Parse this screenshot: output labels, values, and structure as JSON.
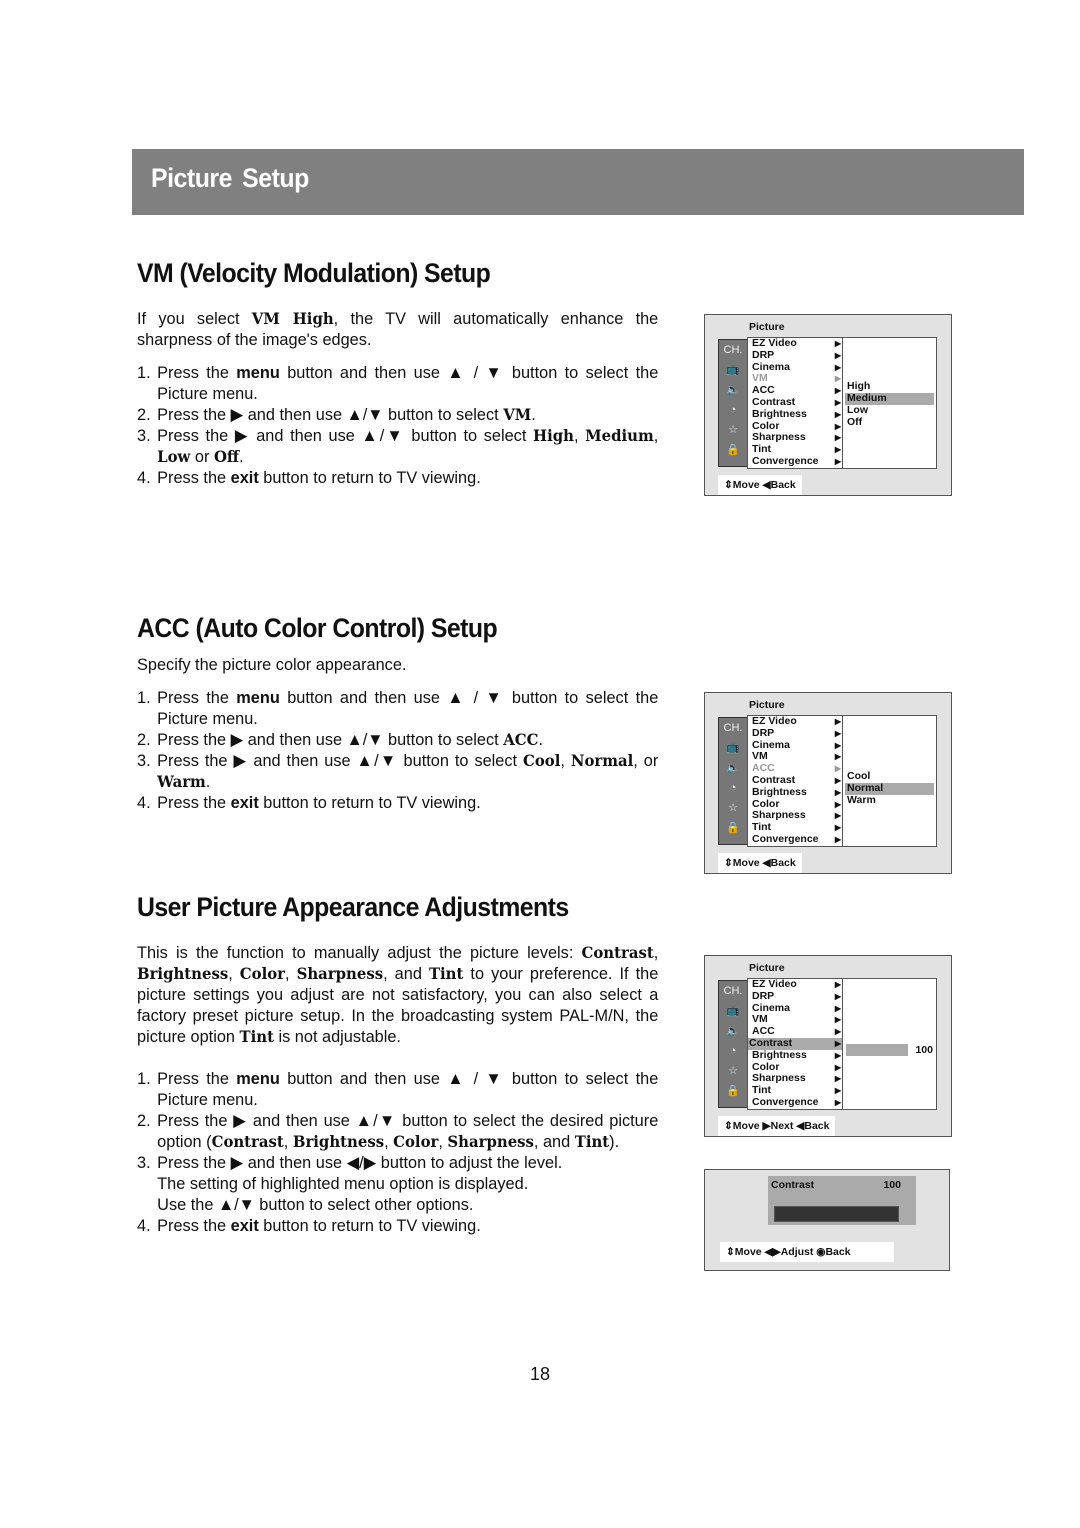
{
  "banner": {
    "title": "Picture  Setup"
  },
  "sections": {
    "vm": {
      "heading": "VM (Velocity Modulation) Setup",
      "intro": [
        "If you select ",
        "VM High",
        ", the TV will automatically enhance the sharpness of the image's edges."
      ],
      "steps": [
        {
          "num": "1.",
          "parts": [
            "Press the ",
            "menu",
            " button and then use ▲ / ▼ button to select the Picture menu."
          ]
        },
        {
          "num": "2.",
          "parts": [
            "Press the ▶ and then use ▲/▼ button to select ",
            "VM",
            "."
          ]
        },
        {
          "num": "3.",
          "parts": [
            "Press the ▶ and then use ▲/▼  button to select ",
            "High",
            ", ",
            "Medium",
            ", ",
            "Low",
            " or ",
            "Off",
            "."
          ]
        },
        {
          "num": "4.",
          "parts": [
            "Press the ",
            "exit",
            " button to return to TV viewing."
          ]
        }
      ],
      "menu": {
        "title": "Picture",
        "items": [
          "EZ Video",
          "DRP",
          "Cinema",
          "VM",
          "ACC",
          "Contrast",
          "Brightness",
          "Color",
          "Sharpness",
          "Tint",
          "Convergence"
        ],
        "active_item": "VM",
        "options": [
          "High",
          "Medium",
          "Low",
          "Off"
        ],
        "selected_option": "Medium",
        "footer": "⇕Move ◀Back"
      }
    },
    "acc": {
      "heading": "ACC (Auto Color Control) Setup",
      "intro": "Specify the picture color appearance.",
      "steps": [
        {
          "num": "1.",
          "parts": [
            "Press the ",
            "menu",
            " button and then use ▲ / ▼ button to select the Picture menu."
          ]
        },
        {
          "num": "2.",
          "parts": [
            "Press the ▶ and then use ▲/▼ button to select ",
            "ACC",
            "."
          ]
        },
        {
          "num": "3.",
          "parts": [
            "Press the ▶ and then use ▲/▼ button to select ",
            "Cool",
            ", ",
            "Normal",
            ", or ",
            "Warm",
            "."
          ]
        },
        {
          "num": "4.",
          "parts": [
            "Press the ",
            "exit",
            " button to return to TV viewing."
          ]
        }
      ],
      "menu": {
        "title": "Picture",
        "items": [
          "EZ Video",
          "DRP",
          "Cinema",
          "VM",
          "ACC",
          "Contrast",
          "Brightness",
          "Color",
          "Sharpness",
          "Tint",
          "Convergence"
        ],
        "active_item": "ACC",
        "options": [
          "Cool",
          "Normal",
          "Warm"
        ],
        "selected_option": "Normal",
        "footer": "⇕Move ◀Back"
      }
    },
    "user": {
      "heading": "User Picture Appearance Adjustments",
      "intro": [
        "This is the function to manually adjust the picture levels: ",
        "Contrast",
        ", ",
        "Brightness",
        ", ",
        "Color",
        ", ",
        "Sharpness",
        ", and ",
        "Tint",
        " to your preference. If the picture settings you adjust are not satisfactory, you can also select a factory preset picture setup. In the broadcasting system PAL-M/N, the picture option ",
        "Tint",
        " is not adjustable."
      ],
      "steps": [
        {
          "num": "1.",
          "parts": [
            "Press the ",
            "menu",
            " button and then use ▲ / ▼ button to select the Picture menu."
          ]
        },
        {
          "num": "2.",
          "parts": [
            "Press the ▶ and then use ▲/▼ button to select the desired picture option (",
            "Contrast",
            ", ",
            "Brightness",
            ", ",
            "Color",
            ", ",
            "Sharpness",
            ", and ",
            "Tint",
            ")."
          ]
        },
        {
          "num": "3.",
          "parts": [
            "Press the ▶ and then use ◀/▶ button to adjust the level.",
            "The setting of highlighted menu option is displayed.",
            "Use the ▲/▼ button to select other options."
          ]
        },
        {
          "num": "4.",
          "parts": [
            "Press the ",
            "exit",
            " button to return to TV viewing."
          ]
        }
      ],
      "menu": {
        "title": "Picture",
        "items": [
          "EZ Video",
          "DRP",
          "Cinema",
          "VM",
          "ACC",
          "Contrast",
          "Brightness",
          "Color",
          "Sharpness",
          "Tint",
          "Convergence"
        ],
        "selected_item": "Contrast",
        "value": "100",
        "footer": "⇕Move ▶Next ◀Back"
      },
      "adjust": {
        "label": "Contrast",
        "value": "100",
        "level_percent": 100,
        "footer": "⇕Move ◀▶Adjust ◉Back"
      }
    }
  },
  "icons": [
    "ch-icon",
    "tv-icon",
    "speaker-icon",
    "clock-icon",
    "star-icon",
    "lock-icon"
  ],
  "page_number": "18"
}
